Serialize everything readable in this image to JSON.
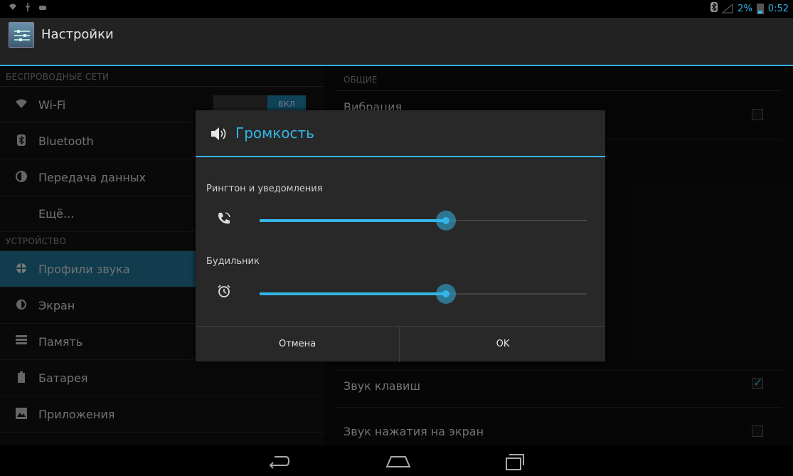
{
  "status_bar": {
    "left_icons": [
      "wifi-icon",
      "usb-icon",
      "android-debug-icon"
    ],
    "bluetooth_icon": "bluetooth-icon",
    "battery_percent": "2%",
    "time": "0:52"
  },
  "action_bar": {
    "title": "Настройки",
    "icon": "settings-app-icon"
  },
  "left_pane": {
    "section_wireless": "БЕСПРОВОДНЫЕ СЕТИ",
    "wifi_label": "Wi-Fi",
    "wifi_toggle": "ВКЛ",
    "bluetooth_label": "Bluetooth",
    "data_label": "Передача данных",
    "more_label": "Ещё...",
    "section_device": "УСТРОЙСТВО",
    "sound_label": "Профили звука",
    "display_label": "Экран",
    "storage_label": "Память",
    "battery_label": "Батарея",
    "apps_label": "Приложения"
  },
  "right_pane": {
    "section_general": "ОБЩИЕ",
    "vibration_label": "Вибрация",
    "key_sounds_label": "Звук клавиш",
    "touch_sounds_label": "Звук нажатия на экран",
    "vibration_checked": false,
    "key_sounds_checked": true,
    "touch_sounds_checked": false
  },
  "dialog": {
    "title": "Громкость",
    "ringtone_label": "Рингтон и уведомления",
    "ringtone_level": 0.57,
    "alarm_label": "Будильник",
    "alarm_level": 0.57,
    "cancel_label": "Отмена",
    "ok_label": "OK"
  },
  "colors": {
    "accent": "#33b5e5",
    "selected_item": "#1e6e8c"
  }
}
